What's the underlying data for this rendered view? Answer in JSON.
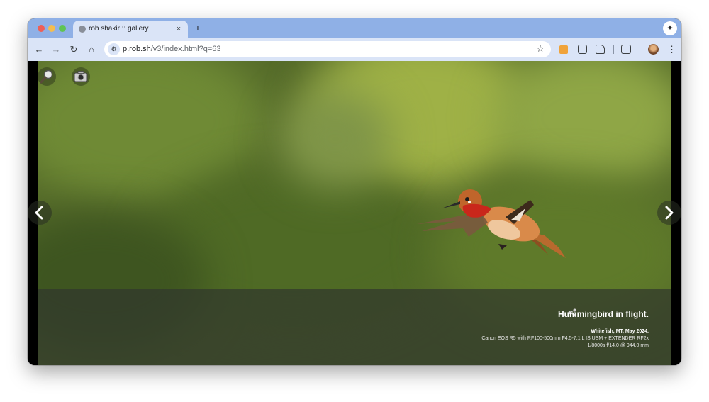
{
  "browser": {
    "tab": {
      "title": "rob shakir :: gallery",
      "close": "×"
    },
    "new_tab": "+",
    "gemini_glyph": "✦",
    "url_host": "p.rob.sh",
    "url_path": "/v3/index.html?q=63",
    "toolbar_glyphs": {
      "back": "←",
      "forward": "→",
      "reload": "↻",
      "home": "⌂",
      "star": "☆",
      "menu": "⋮",
      "site_info": "⚙"
    }
  },
  "gallery": {
    "tool_icons": [
      "magnifier-icon",
      "camera-icon"
    ],
    "caption": {
      "title": "Hummingbird in flight.",
      "location": "Whitefish, MT, May 2024.",
      "gear": "Canon EOS R5 with RF100-500mm F4.5-7.1 L IS USM + EXTENDER RF2x",
      "exposure": "1/8000s f/14.0 @ 944.0 mm"
    }
  },
  "colors": {
    "tab_strip": "#8fb0e6",
    "toolbar": "#dae4f7",
    "photo_bg": "#556b2a",
    "caption_overlay": "#30372c"
  }
}
